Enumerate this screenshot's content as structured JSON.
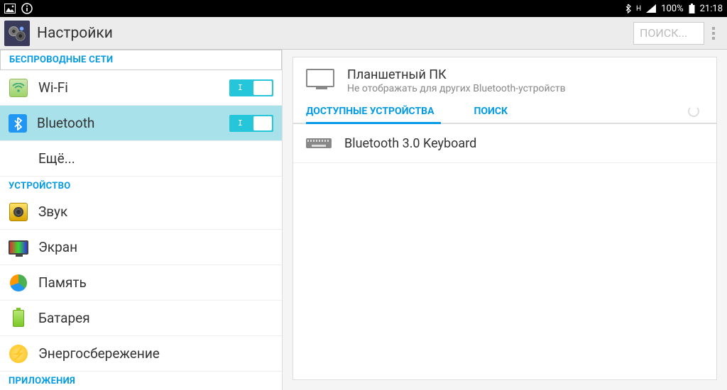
{
  "status": {
    "battery_pct": "100%",
    "clock": "21:18",
    "network_label": "H"
  },
  "header": {
    "title": "Настройки",
    "search_placeholder": "ПОИСК..."
  },
  "sidebar": {
    "section_wireless": "БЕСПРОВОДНЫЕ СЕТИ",
    "wifi": "Wi-Fi",
    "bluetooth": "Bluetooth",
    "more": "Ещё...",
    "section_device": "УСТРОЙСТВО",
    "sound": "Звук",
    "screen": "Экран",
    "memory": "Память",
    "battery": "Батарея",
    "energy": "Энергосбережение",
    "section_apps": "ПРИЛОЖЕНИЯ"
  },
  "panel": {
    "device_name": "Планшетный ПК",
    "device_sub": "Не отображать для других Bluetooth-устройств",
    "tab_available": "ДОСТУПНЫЕ УСТРОЙСТВА",
    "tab_scan": "ПОИСК",
    "found": [
      {
        "name": "Bluetooth 3.0 Keyboard",
        "type": "keyboard"
      }
    ]
  },
  "toggles": {
    "wifi": true,
    "bluetooth": true
  },
  "colors": {
    "accent": "#039be5",
    "toggle": "#26c6da",
    "selected": "#a8e1e9"
  }
}
